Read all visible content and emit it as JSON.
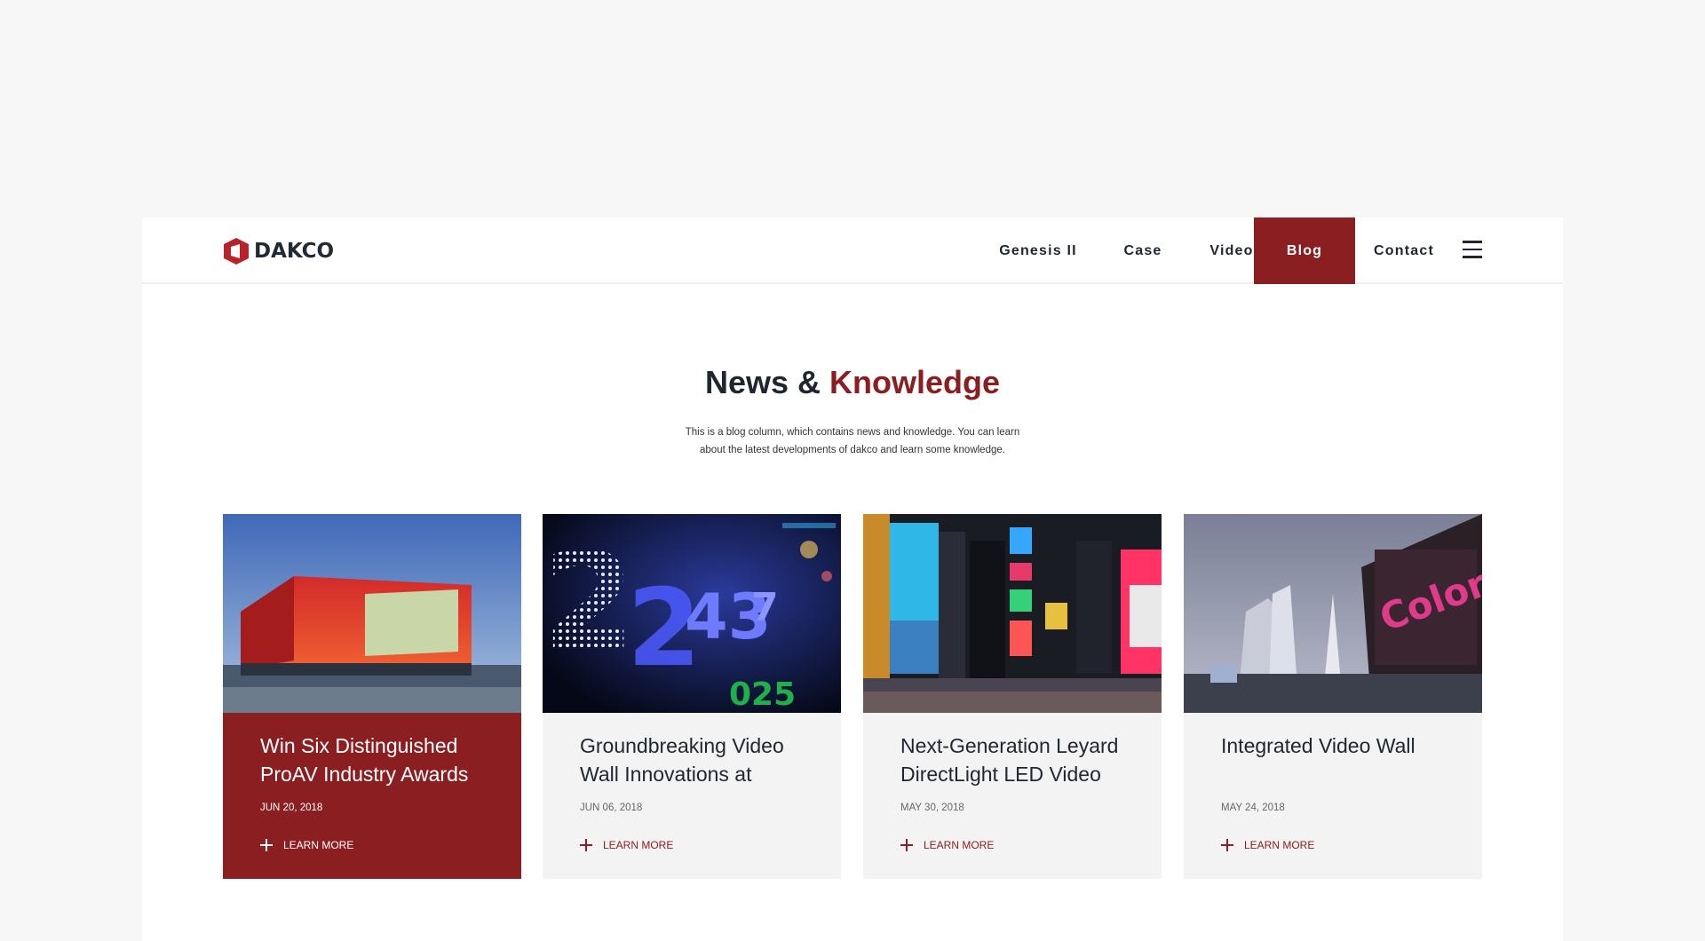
{
  "brand": {
    "name": "DAKCO",
    "accent": "#8a1e21"
  },
  "nav": {
    "items": [
      {
        "label": "Genesis II"
      },
      {
        "label": "Case"
      },
      {
        "label": "Video"
      },
      {
        "label": "Blog",
        "active": true
      },
      {
        "label": "Contact"
      }
    ],
    "menu_icon": "hamburger-menu-icon"
  },
  "section": {
    "title_part1": "News &",
    "title_part2": "Knowledge",
    "intro_line1": "This is a blog column, which contains news and knowledge. You can learn",
    "intro_line2": "about the latest developments of dakco and learn some knowledge."
  },
  "posts": [
    {
      "title": "Win Six Distinguished ProAV Industry Awards",
      "date": "JUN 20, 2018",
      "more": "LEARN MORE",
      "image": "building-with-red-led-facade",
      "active": true
    },
    {
      "title": "Groundbreaking Video Wall Innovations at",
      "date": "JUN 06, 2018",
      "more": "LEARN MORE",
      "image": "blue-led-number-display"
    },
    {
      "title": "Next-Generation Leyard DirectLight LED Video",
      "date": "MAY 30, 2018",
      "more": "LEARN MORE",
      "image": "times-square-night"
    },
    {
      "title": "Integrated Video Wall",
      "date": "MAY 24, 2018",
      "more": "LEARN MORE",
      "image": "city-skyline-led-sign"
    }
  ]
}
